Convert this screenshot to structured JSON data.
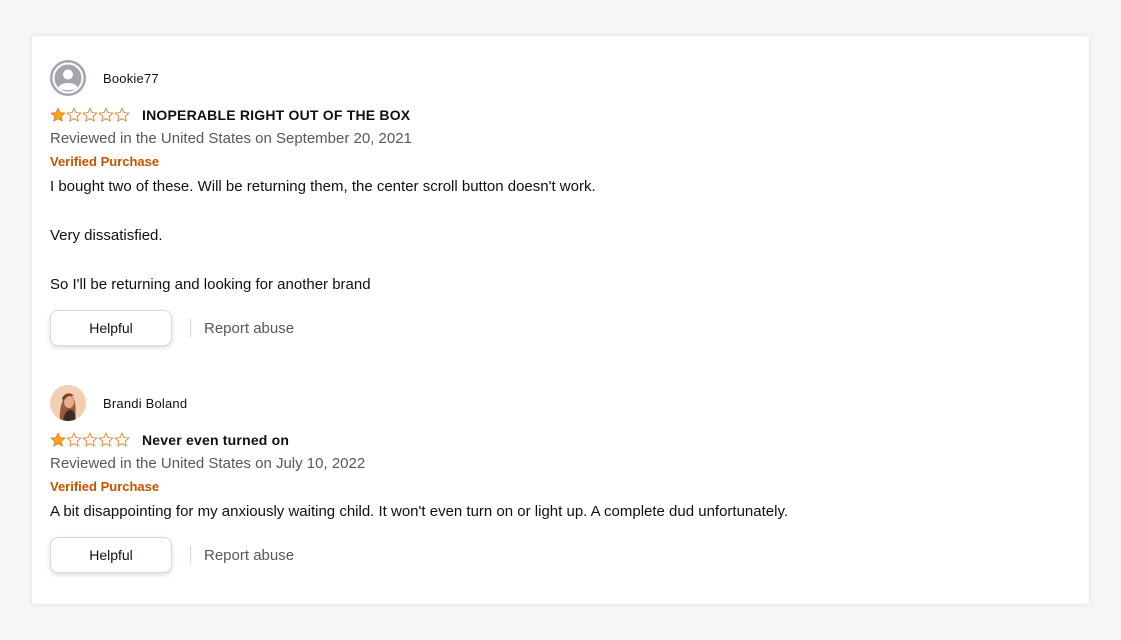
{
  "reviews": [
    {
      "author": "Bookie77",
      "avatar": "default-user-icon",
      "rating": 1,
      "max_rating": 5,
      "title": "INOPERABLE RIGHT OUT OF THE BOX",
      "date_line": "Reviewed in the United States on September 20, 2021",
      "verified": "Verified Purchase",
      "body": [
        "I bought two of these. Will be returning them, the center scroll button doesn't work.",
        "Very dissatisfied.",
        "So I'll be returning and looking for another brand"
      ],
      "helpful_label": "Helpful",
      "report_label": "Report abuse"
    },
    {
      "author": "Brandi Boland",
      "avatar": "user-photo",
      "rating": 1,
      "max_rating": 5,
      "title": "Never even turned on",
      "date_line": "Reviewed in the United States on July 10, 2022",
      "verified": "Verified Purchase",
      "body": [
        "A bit disappointing for my anxiously waiting child. It won't even turn on or light up. A complete dud unfortunately."
      ],
      "helpful_label": "Helpful",
      "report_label": "Report abuse"
    }
  ],
  "colors": {
    "star_fill": "#ffa41c",
    "star_outline": "#de7921",
    "verified": "#c45500",
    "muted_text": "#565959",
    "primary_text": "#0f1111"
  }
}
